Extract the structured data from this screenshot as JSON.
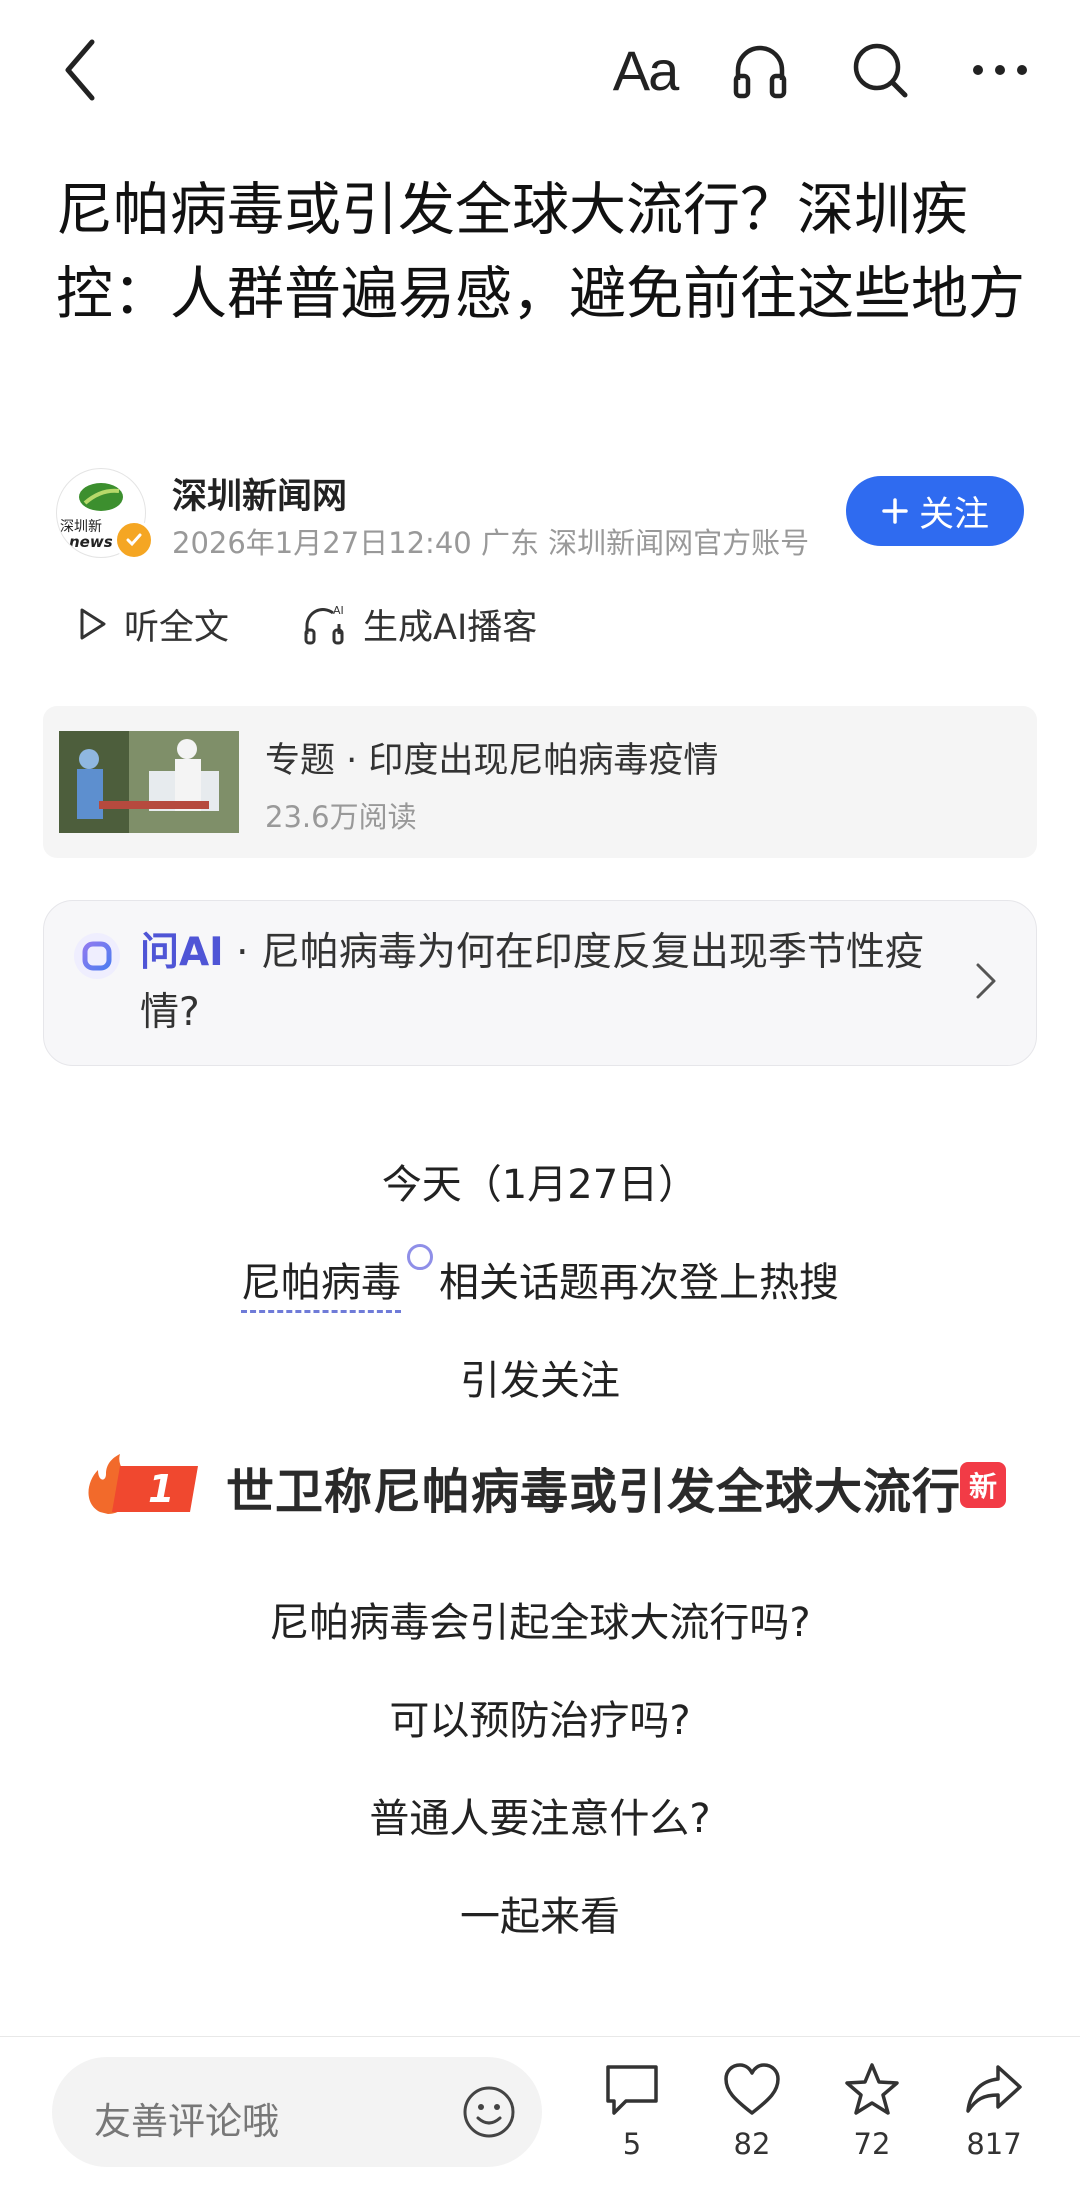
{
  "topbar": {
    "font_size_label": "Aa",
    "icons": [
      "back-icon",
      "font-size-icon",
      "headphones-icon",
      "search-icon",
      "more-icon"
    ]
  },
  "article": {
    "title": "尼帕病毒或引发全球大流行？深圳疾控：人群普遍易感，避免前往这些地方"
  },
  "author": {
    "name": "深圳新闻网",
    "avatar_text": "深圳新",
    "avatar_subtext": "news",
    "meta": "2026年1月27日12:40 广东 深圳新闻网官方账号",
    "follow_label": "关注",
    "follow_color": "#2f6bf0"
  },
  "listen": {
    "full_text_label": "听全文",
    "ai_podcast_label": "生成AI播客",
    "ai_badge": "AI"
  },
  "topic": {
    "title": "专题 · 印度出现尼帕病毒疫情",
    "reads": "23.6万阅读"
  },
  "ask_ai": {
    "brand": "问AI",
    "question": " · 尼帕病毒为何在印度反复出现季节性疫情?",
    "brand_color": "#4f55d6"
  },
  "body": {
    "line1": "今天（1月27日）",
    "keyword": "尼帕病毒",
    "line2_rest": "相关话题再次登上热搜",
    "line3": "引发关注",
    "q1": "尼帕病毒会引起全球大流行吗?",
    "q2": "可以预防治疗吗?",
    "q3": "普通人要注意什么?",
    "q4": "一起来看"
  },
  "hot_search": {
    "rank": "1",
    "text": "世卫称尼帕病毒或引发全球大流行",
    "badge": "新",
    "rank_color": "#f0482f"
  },
  "bottom": {
    "comment_placeholder": "友善评论哦",
    "comments": "5",
    "likes": "82",
    "favorites": "72",
    "shares": "817"
  }
}
